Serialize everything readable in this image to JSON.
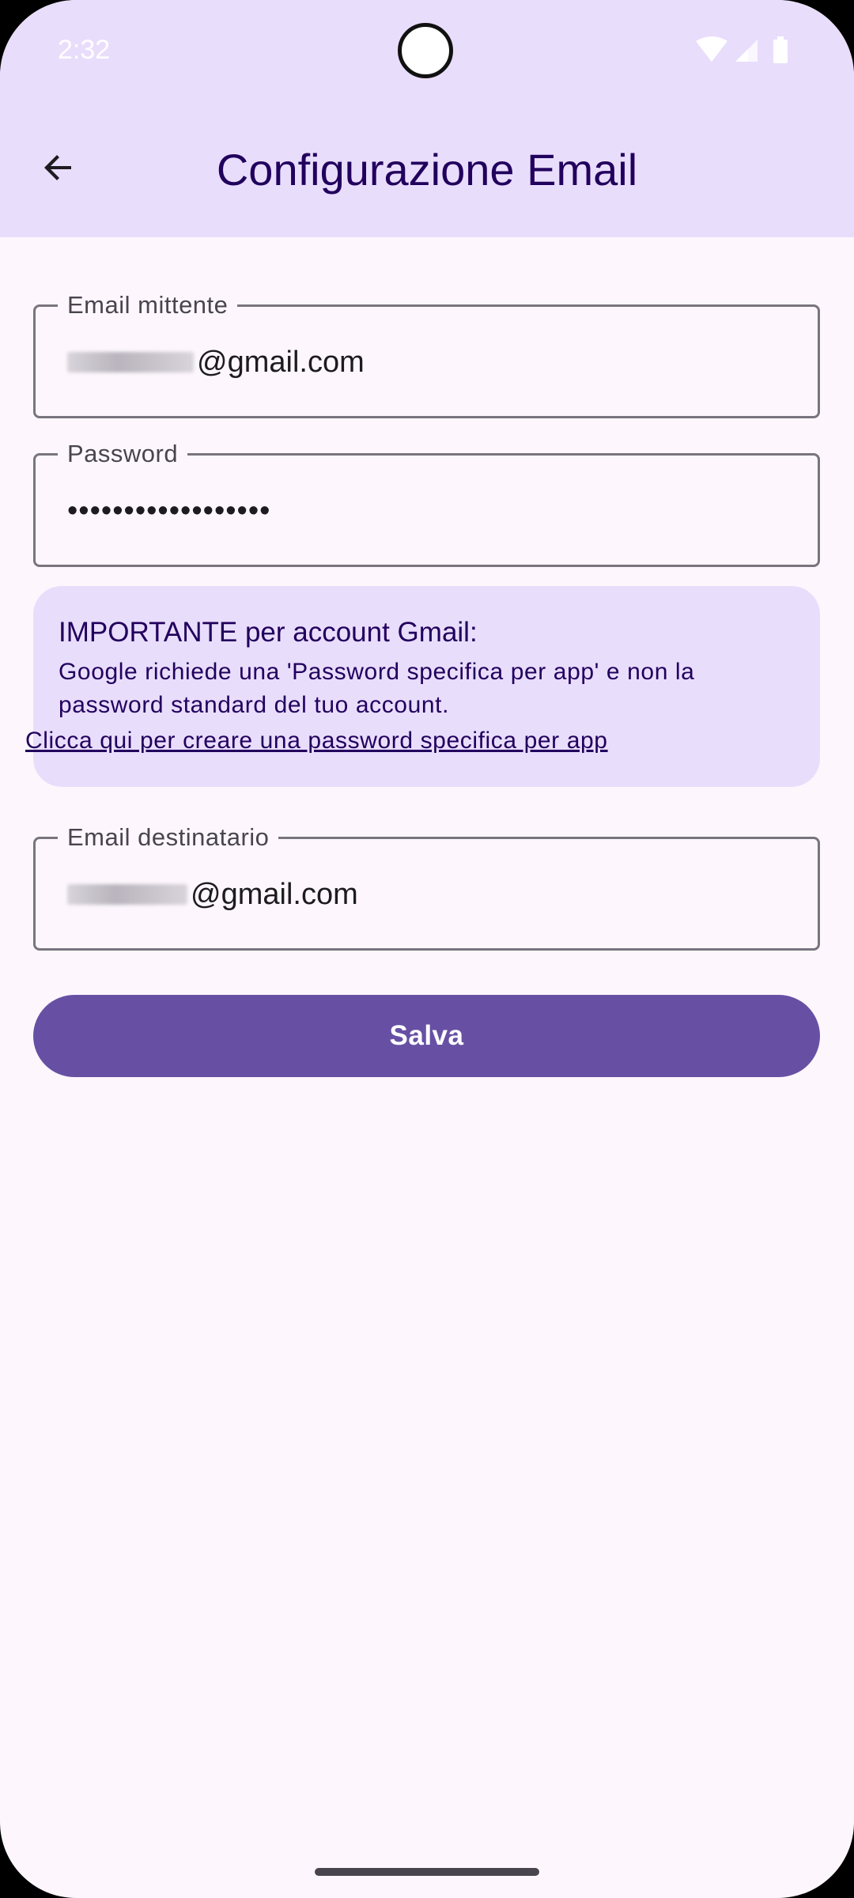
{
  "status_bar": {
    "time": "2:32",
    "icons": [
      "wifi-icon",
      "cellular-signal-icon",
      "battery-icon"
    ]
  },
  "app_bar": {
    "back_icon": "arrow-back-icon",
    "title": "Configurazione Email"
  },
  "form": {
    "sender": {
      "label": "Email mittente",
      "value_suffix": "@gmail.com"
    },
    "password": {
      "label": "Password",
      "value": "••••••••••••••••••"
    },
    "recipient": {
      "label": "Email destinatario",
      "value_suffix": "@gmail.com"
    }
  },
  "info_card": {
    "title": "IMPORTANTE per account Gmail:",
    "text": "Google richiede una 'Password specifica per app' e non la password standard del tuo account.",
    "link": "Clicca qui per creare una password specifica per app"
  },
  "save_button": {
    "label": "Salva"
  },
  "colors": {
    "primary": "#6750a4",
    "app_bar_bg": "#e9ddfc",
    "background": "#fdf7fd",
    "on_primary_container": "#21005d",
    "outline": "#79747e"
  }
}
